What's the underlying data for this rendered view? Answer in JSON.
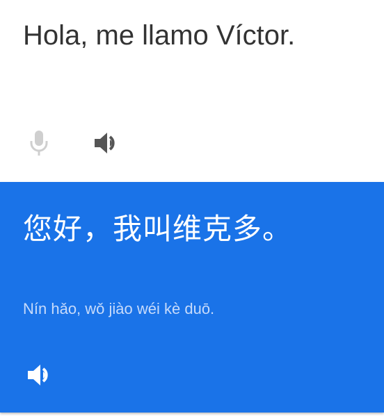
{
  "source": {
    "text": "Hola, me llamo Víctor.",
    "mic_icon": "microphone-icon",
    "speaker_icon": "speaker-icon",
    "text_color": "#333333",
    "mic_color": "#cfcfcf",
    "speaker_color": "#555555"
  },
  "target": {
    "text": "您好，我叫维克多。",
    "romanization": "Nín hǎo, wǒ jiào wéi kè duō.",
    "speaker_icon": "speaker-icon",
    "background_color": "#1a73e8",
    "text_color": "#ffffff",
    "romanization_color": "#c7dbfb"
  }
}
